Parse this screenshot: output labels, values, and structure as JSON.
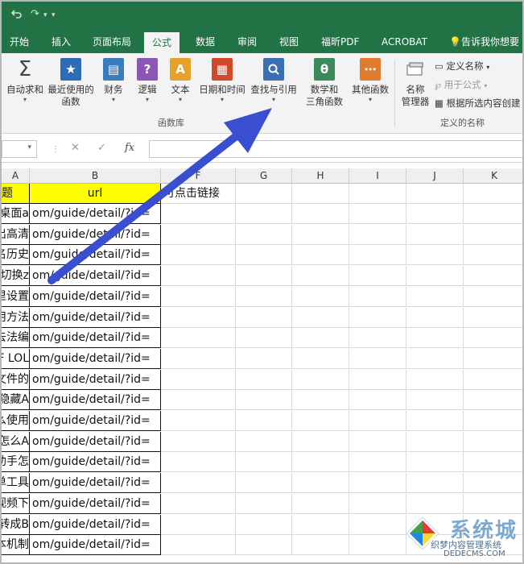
{
  "colors": {
    "excel_green": "#217346",
    "ribbon_bg": "#f3f3f3",
    "header_fill": "#ffff00",
    "arrow": "#3a4fd0"
  },
  "qat": {
    "redo": "↷",
    "separator": "▾",
    "more": "▾"
  },
  "tabs": [
    {
      "label": "开始",
      "active": false
    },
    {
      "label": "插入",
      "active": false
    },
    {
      "label": "页面布局",
      "active": false
    },
    {
      "label": "公式",
      "active": true
    },
    {
      "label": "数据",
      "active": false
    },
    {
      "label": "审阅",
      "active": false
    },
    {
      "label": "视图",
      "active": false
    },
    {
      "label": "福昕PDF",
      "active": false
    },
    {
      "label": "ACROBAT",
      "active": false
    }
  ],
  "tell_me": "告诉我你想要",
  "ribbon": {
    "autosum": "自动求和",
    "recent_1": "最近使用的",
    "recent_2": "函数",
    "financial": "财务",
    "logical": "逻辑",
    "text": "文本",
    "datetime": "日期和时间",
    "lookup": "查找与引用",
    "math_1": "数学和",
    "math_2": "三角函数",
    "more_funcs": "其他函数",
    "group_library": "函数库",
    "name_mgr_1": "名称",
    "name_mgr_2": "管理器",
    "define_name": "定义名称",
    "use_in_formula": "用于公式",
    "create_from_sel": "根据所选内容创建",
    "group_names": "定义的名称"
  },
  "formula_bar": {
    "cancel": "✕",
    "enter": "✓",
    "fx": "fx",
    "value": ""
  },
  "columns": [
    "A",
    "B",
    "F",
    "G",
    "H",
    "I",
    "J",
    "K"
  ],
  "header_row": {
    "a": "题",
    "b": "url",
    "f": "可点击链接"
  },
  "rows": [
    {
      "a": "桌面a",
      "b": "om/guide/detail/?id="
    },
    {
      "a": "出高清",
      "b": "om/guide/detail/?id="
    },
    {
      "a": "名历史",
      "b": "om/guide/detail/?id="
    },
    {
      "a": "切换z",
      "b": "om/guide/detail/?id="
    },
    {
      "a": "里设置",
      "b": "om/guide/detail/?id="
    },
    {
      "a": "用方法",
      "b": "om/guide/detail/?id="
    },
    {
      "a": "去法编",
      "b": "om/guide/detail/?id="
    },
    {
      "a": "F LOL",
      "b": "om/guide/detail/?id="
    },
    {
      "a": "文件的",
      "b": "om/guide/detail/?id="
    },
    {
      "a": "隐藏A",
      "b": "om/guide/detail/?id="
    },
    {
      "a": "么使用",
      "b": "om/guide/detail/?id="
    },
    {
      "a": "怎么A",
      "b": "om/guide/detail/?id="
    },
    {
      "a": "助手怎",
      "b": "om/guide/detail/?id="
    },
    {
      "a": "单工具",
      "b": "om/guide/detail/?id="
    },
    {
      "a": "视频下",
      "b": "om/guide/detail/?id="
    },
    {
      "a": "转成B",
      "b": "om/guide/detail/?id="
    },
    {
      "a": "本机制",
      "b": "om/guide/detail/?id="
    }
  ],
  "watermark": {
    "big": "系统城",
    "small": "织梦内容管理系统",
    "url": "DEDECMS.COM"
  }
}
